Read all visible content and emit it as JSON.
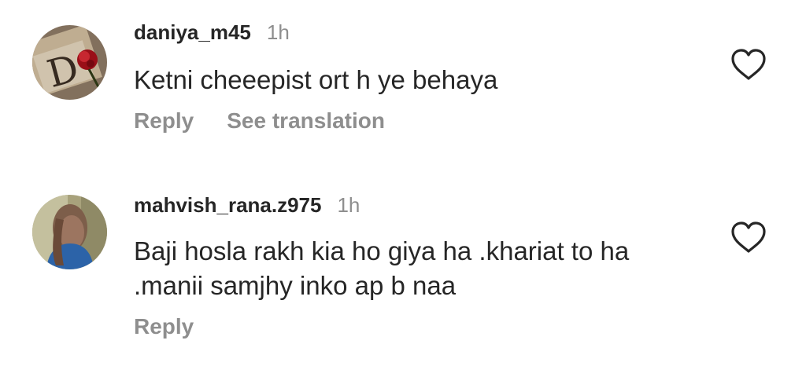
{
  "colors": {
    "text": "#262626",
    "muted": "#8e8e8e",
    "background": "#ffffff"
  },
  "comments": [
    {
      "username": "daniya_m45",
      "time": "1h",
      "text": "Ketni cheeepist ort h ye behaya",
      "actions": [
        "Reply",
        "See translation"
      ],
      "avatar_icon": "rose-and-letter-photo",
      "like_icon": "heart-outline-icon"
    },
    {
      "username": "mahvish_rana.z975",
      "time": "1h",
      "text": "Baji hosla rakh kia  ho giya ha .khariat to ha .manii samjhy inko ap b naa",
      "actions": [
        "Reply"
      ],
      "avatar_icon": "woman-profile-photo",
      "like_icon": "heart-outline-icon"
    }
  ]
}
